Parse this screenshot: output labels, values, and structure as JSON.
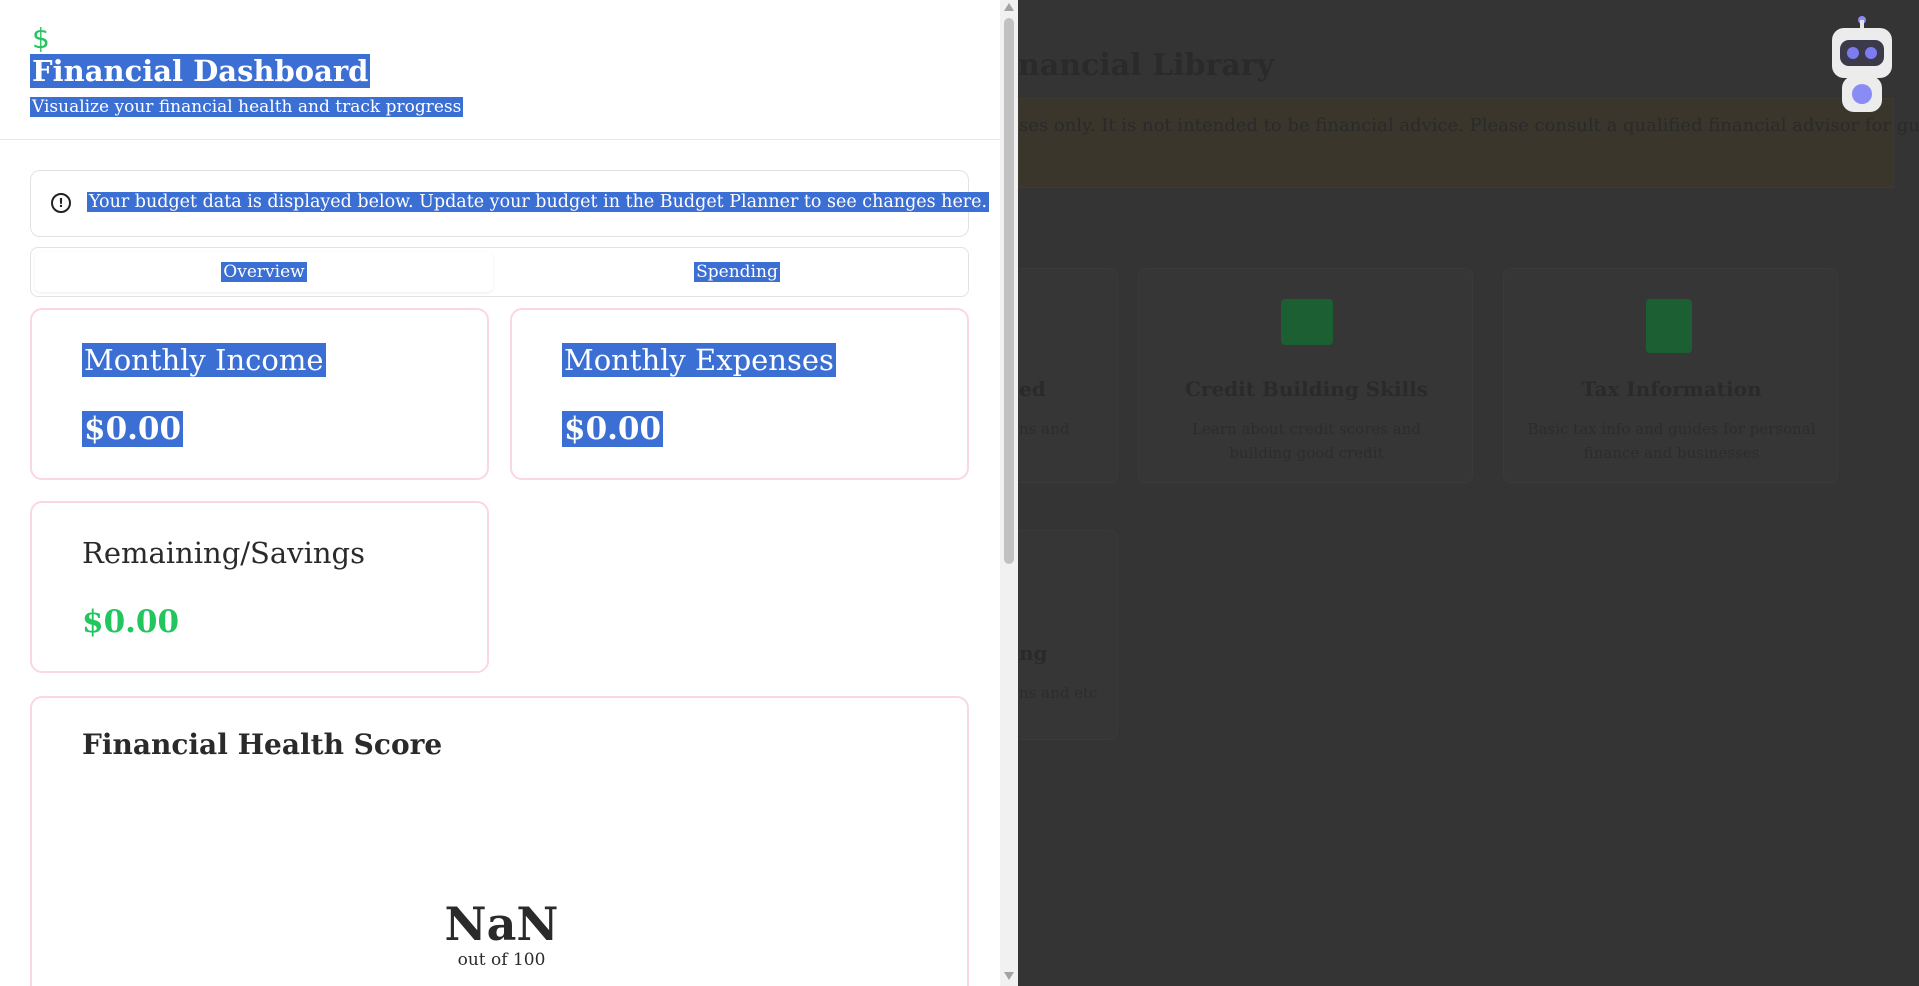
{
  "header": {
    "icon": "dollar-icon",
    "title": "Financial Dashboard",
    "subtitle": "Visualize your financial health and track progress"
  },
  "alert": {
    "icon": "alert-circle-icon",
    "text": "Your budget data is displayed below. Update your budget in the Budget Planner to see changes here."
  },
  "tabs": [
    {
      "label": "Overview",
      "active": true
    },
    {
      "label": "Spending",
      "active": false
    }
  ],
  "cards": {
    "income": {
      "label": "Monthly Income",
      "value": "$0.00"
    },
    "expenses": {
      "label": "Monthly Expenses",
      "value": "$0.00"
    },
    "savings": {
      "label": "Remaining/Savings",
      "value": "$0.00"
    }
  },
  "health": {
    "title": "Financial Health Score",
    "score": "NaN",
    "score_sub": "out of 100"
  },
  "background": {
    "title_fragment": "nancial Library",
    "banner_text": "ses only. It is not intended to be financial advice. Please consult a qualified financial advisor for guidanc",
    "cards": [
      {
        "title": "ed",
        "desc": "ns and"
      },
      {
        "title": "Credit Building Skills",
        "desc": "Learn about credit scores and building good credit"
      },
      {
        "title": "Tax Information",
        "desc": "Basic tax info and guides for personal finance and businesses"
      },
      {
        "title": "ng",
        "desc": "ns and etc"
      }
    ]
  },
  "colors": {
    "accent_green": "#22c55e",
    "selection": "#3b6fd3",
    "card_border": "#fbd7df",
    "overlay": "#343434"
  }
}
